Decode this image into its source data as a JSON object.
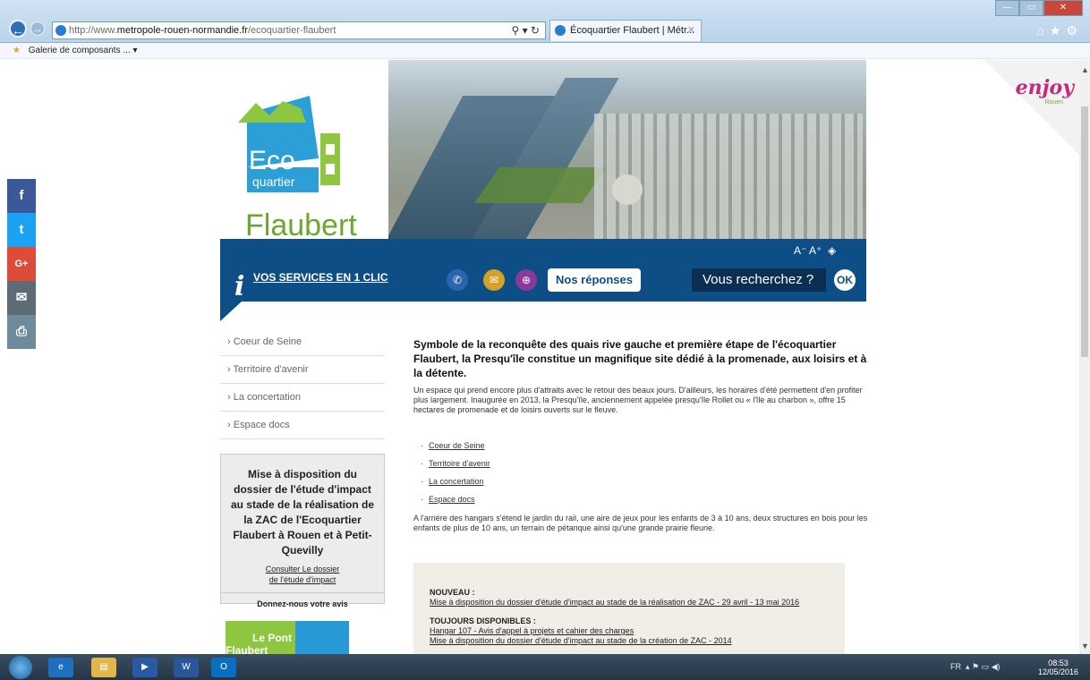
{
  "browser": {
    "url_prefix": "http://www.",
    "url_domain": "metropole-rouen-normandie.fr",
    "url_path": "/ecoquartier-flaubert",
    "tab_title": "Écoquartier Flaubert | Métr...",
    "favorites_item": "Galerie de composants ..."
  },
  "header": {
    "logo_eco": "Eco",
    "logo_quartier": "quartier",
    "logo_flaubert": "Flaubert",
    "services_label": "VOS SERVICES EN 1 CLIC",
    "font_controls": "A⁻  A⁺",
    "reponses_label": "Nos réponses",
    "search_placeholder": "Vous recherchez ?",
    "ok_label": "OK"
  },
  "enjoy": {
    "brand": "enjoy",
    "sub": "Rouen"
  },
  "sidenav": {
    "items": [
      "› Coeur de Seine",
      "› Territoire d'avenir",
      "› La concertation",
      "› Espace docs"
    ]
  },
  "dossier": {
    "title": "Mise à disposition du dossier de l'étude d'impact au stade de la réalisation de la ZAC de l'Ecoquartier Flaubert à Rouen et à Petit-Quevilly",
    "link1": "Consulter Le dossier",
    "link2": "de l'étude d'impact",
    "avis": "Donnez-nous votre avis"
  },
  "pont": {
    "line1": "Le Pont",
    "line2": "Flaubert"
  },
  "content": {
    "heading": "Symbole de la reconquête des quais rive gauche et première étape de l'écoquartier Flaubert, la Presqu'île constitue un magnifique site dédié à la promenade, aux loisirs et à la détente.",
    "para1": "Un espace qui prend encore plus d'attraits avec le retour des beaux jours. D'ailleurs, les horaires d'été permettent d'en profiter plus largement. Inaugurée en 2013, la Presqu'île, anciennement appelée presqu'île Rollet ou « l'île au charbon », offre 15 hectares de promenade et de loisirs ouverts sur le fleuve.",
    "links": [
      "Coeur de Seine",
      "Territoire d'avenir",
      "La concertation",
      "Espace docs"
    ],
    "para2": "A l'arrière des hangars s'étend le jardin du rail, une aire de jeux pour les enfants de 3 à 10 ans, deux structures en bois pour les enfants de plus de 10 ans, un terrain de pétanque ainsi qu'une grande prairie fleurie."
  },
  "news": {
    "nouveau_label": "NOUVEAU :",
    "nouveau_link": "Mise à disposition du dossier d'étude d'impact au stade de la réalisation de ZAC - 29 avril - 13 mai 2016",
    "toujours_label": "TOUJOURS DISPONIBLES :",
    "toujours_link1": "Hangar 107 - Avis d'appel à projets et cahier des charges",
    "toujours_link2": "Mise à disposition du dossier d'étude d'impact au stade de la création de ZAC - 2014"
  },
  "taskbar": {
    "lang": "FR",
    "time": "08:53",
    "date": "12/05/2016"
  },
  "social_icons": [
    "facebook-icon",
    "twitter-icon",
    "google-plus-icon",
    "email-icon",
    "print-icon"
  ],
  "colors": {
    "brand_blue": "#0e4e86",
    "facebook": "#3b5998",
    "twitter": "#1da1f2",
    "gplus": "#dd4b39",
    "mail": "#5c6b75",
    "print": "#6f8a9a"
  }
}
